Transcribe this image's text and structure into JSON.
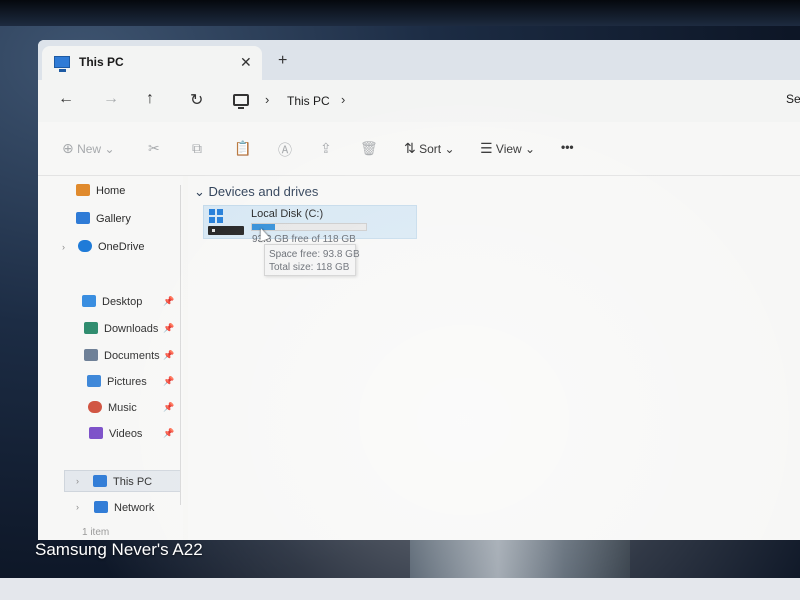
{
  "camera_watermark": "Samsung Never's A22",
  "window": {
    "tab": {
      "title": "This PC",
      "close_glyph": "✕",
      "icon": "monitor-icon"
    },
    "new_tab_glyph": "+",
    "nav": {
      "back_glyph": "←",
      "forward_glyph": "→",
      "up_glyph": "↑",
      "refresh_glyph": "↻",
      "breadcrumb": [
        "This PC"
      ],
      "separator_glyph": "›",
      "search_stub": "Se"
    },
    "toolbar": {
      "new_label": "New",
      "new_glyph": "⊕",
      "cut_glyph": "✂",
      "copy_glyph": "⧉",
      "paste_glyph": "📋",
      "rename_glyph": "Ⓐ",
      "share_glyph": "⇪",
      "delete_glyph": "🗑",
      "sort_label": "Sort",
      "sort_glyph": "⇅",
      "view_label": "View",
      "view_glyph": "☰",
      "more_glyph": "•••",
      "dropdown_glyph": "⌄"
    },
    "sidebar": {
      "top_items": [
        {
          "label": "Home",
          "icon": "home-icon",
          "color": "#e08a2c"
        },
        {
          "label": "Gallery",
          "icon": "gallery-icon",
          "color": "#2f7bd6"
        },
        {
          "label": "OneDrive",
          "icon": "cloud-icon",
          "color": "#1f7bd8"
        }
      ],
      "pinned_items": [
        {
          "label": "Desktop",
          "icon": "desktop-icon",
          "color": "#3a8ee0"
        },
        {
          "label": "Downloads",
          "icon": "download-icon",
          "color": "#2f8c6e"
        },
        {
          "label": "Documents",
          "icon": "documents-icon",
          "color": "#6d7f96"
        },
        {
          "label": "Pictures",
          "icon": "pictures-icon",
          "color": "#3c86d8"
        },
        {
          "label": "Music",
          "icon": "music-icon",
          "color": "#d0523f"
        },
        {
          "label": "Videos",
          "icon": "videos-icon",
          "color": "#7b4fc8"
        }
      ],
      "bottom_items": [
        {
          "label": "This PC",
          "icon": "this-pc-icon",
          "color": "#2f7bd6",
          "selected": true
        },
        {
          "label": "Network",
          "icon": "network-icon",
          "color": "#2f7bd6"
        }
      ],
      "pin_glyph": "📌",
      "status": "1 item"
    },
    "content": {
      "section_title": "Devices and drives",
      "drives": [
        {
          "name": "Local Disk (C:)",
          "free_text": "93.8 GB free of 118 GB",
          "used_fraction": 0.2,
          "bar_color": "#2a8ad6"
        }
      ],
      "tooltip": {
        "space_free": "Space free: 93.8 GB",
        "total_size": "Total size: 118 GB"
      }
    }
  }
}
